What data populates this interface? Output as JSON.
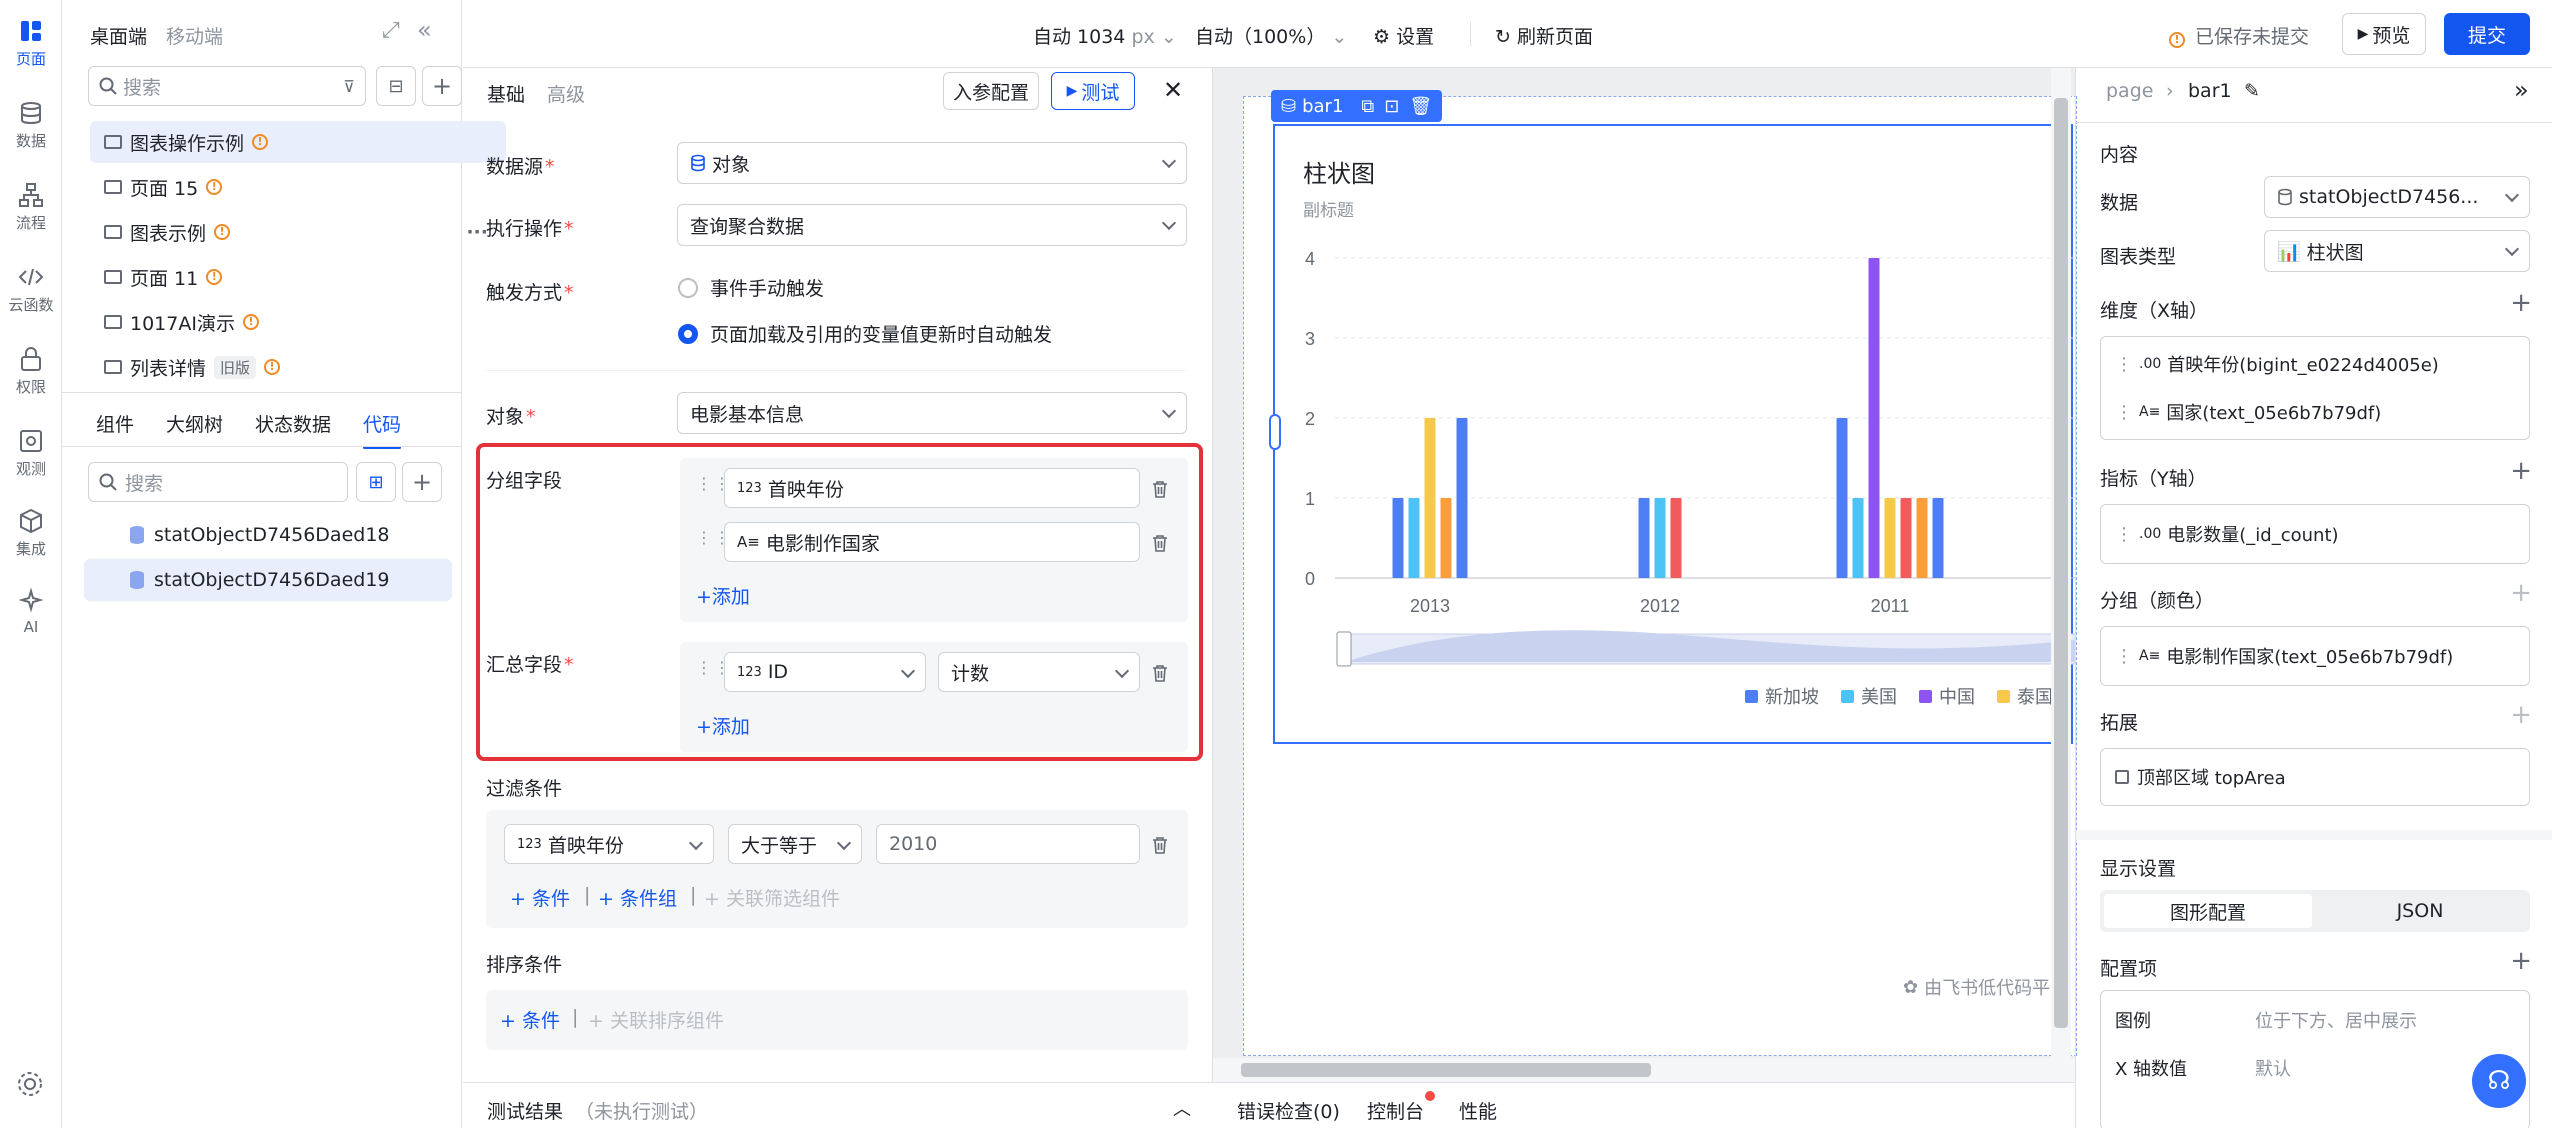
{
  "rail": {
    "items": [
      {
        "label": "页面",
        "icon": "pages-icon"
      },
      {
        "label": "数据",
        "icon": "database-icon"
      },
      {
        "label": "流程",
        "icon": "flow-icon"
      },
      {
        "label": "云函数",
        "icon": "code-icon"
      },
      {
        "label": "权限",
        "icon": "lock-icon"
      },
      {
        "label": "观测",
        "icon": "monitor-icon"
      },
      {
        "label": "集成",
        "icon": "cube-icon"
      },
      {
        "label": "AI",
        "icon": "sparkle-icon"
      }
    ]
  },
  "leftpanel": {
    "platform_tabs": [
      "桌面端",
      "移动端"
    ],
    "search_placeholder": "搜索",
    "pages": [
      {
        "label": "图表操作示例"
      },
      {
        "label": "页面 15"
      },
      {
        "label": "图表示例"
      },
      {
        "label": "页面 11"
      },
      {
        "label": "1017AI演示"
      },
      {
        "label": "列表详情",
        "badge": "旧版"
      }
    ],
    "more": "···",
    "tabs": [
      "组件",
      "大纲树",
      "状态数据",
      "代码"
    ],
    "code_search_placeholder": "搜索",
    "code_items": [
      "statObjectD7456Daed18",
      "statObjectD7456Daed19"
    ]
  },
  "topbar": {
    "width_label": "自动 1034",
    "width_unit": "px",
    "zoom_label": "自动（100%）",
    "settings_label": "设置",
    "refresh_label": "刷新页面",
    "unsaved_label": "已保存未提交",
    "preview_label": "预览",
    "submit_label": "提交"
  },
  "config": {
    "tabs": [
      "基础",
      "高级"
    ],
    "params_button": "入参配置",
    "test_button": "测试",
    "datasource_label": "数据源",
    "datasource_value": "对象",
    "operation_label": "执行操作",
    "operation_value": "查询聚合数据",
    "trigger_label": "触发方式",
    "trigger_options": [
      "事件手动触发",
      "页面加载及引用的变量值更新时自动触发"
    ],
    "object_label": "对象",
    "object_value": "电影基本信息",
    "group_label": "分组字段",
    "group_fields": [
      {
        "type": "123",
        "name": "首映年份"
      },
      {
        "type": "A≡",
        "name": "电影制作国家"
      }
    ],
    "add_label": "添加",
    "agg_label": "汇总字段",
    "agg_field_type": "123",
    "agg_field": "ID",
    "agg_func": "计数",
    "filter_label": "过滤条件",
    "filter_field_type": "123",
    "filter_field": "首映年份",
    "filter_op": "大于等于",
    "filter_value": "2010",
    "cond_label": "条件",
    "cond_group_label": "条件组",
    "link_filter_label": "关联筛选组件",
    "sort_label": "排序条件",
    "link_sort_label": "关联排序组件",
    "result_label": "测试结果",
    "result_status": "（未执行测试）"
  },
  "canvas": {
    "component_tag": "bar1",
    "watermark": "由飞书低代码平"
  },
  "chart_data": {
    "type": "bar",
    "title": "柱状图",
    "subtitle": "副标题",
    "categories": [
      "2013",
      "2012",
      "2011"
    ],
    "yticks": [
      "0",
      "1",
      "2",
      "3",
      "4"
    ],
    "ylim": [
      0,
      4
    ],
    "series_values": [
      [
        1,
        1,
        2,
        1,
        2
      ],
      [
        1,
        1,
        1
      ],
      [
        2,
        1,
        4,
        1,
        1,
        1,
        1
      ]
    ],
    "series_colors": [
      [
        "#4e7ef6",
        "#4cc3f4",
        "#f7c948",
        "#f99e3b",
        "#4e7ef6"
      ],
      [
        "#4e7ef6",
        "#4cc3f4",
        "#f25b5b"
      ],
      [
        "#4e7ef6",
        "#4cc3f4",
        "#8e54f1",
        "#f7c948",
        "#f25b5b",
        "#f99e3b",
        "#4e7ef6"
      ]
    ],
    "legend": [
      {
        "name": "新加坡",
        "color": "#4e7ef6"
      },
      {
        "name": "美国",
        "color": "#4cc3f4"
      },
      {
        "name": "中国",
        "color": "#8e54f1"
      },
      {
        "name": "泰国",
        "color": "#f7c948"
      }
    ]
  },
  "right": {
    "breadcrumb_root": "page",
    "breadcrumb_current": "bar1",
    "content_label": "内容",
    "data_label": "数据",
    "data_value": "statObjectD7456...",
    "chart_type_label": "图表类型",
    "chart_type_value": "柱状图",
    "dimension_label": "维度（X轴）",
    "dimension_items": [
      {
        "type": ".00",
        "name": "首映年份(bigint_e0224d4005e)"
      },
      {
        "type": "A≡",
        "name": "国家(text_05e6b7b79df)"
      }
    ],
    "metric_label": "指标（Y轴）",
    "metric_items": [
      {
        "type": ".00",
        "name": "电影数量(_id_count)"
      }
    ],
    "group_label": "分组（颜色）",
    "group_items": [
      {
        "type": "A≡",
        "name": "电影制作国家(text_05e6b7b79df)"
      }
    ],
    "extend_label": "拓展",
    "extend_item": "顶部区域 topArea",
    "display_label": "显示设置",
    "display_tabs": [
      "图形配置",
      "JSON"
    ],
    "config_label": "配置项",
    "config_rows": [
      {
        "key": "图例",
        "value": "位于下方、居中展示"
      },
      {
        "key": "X 轴数值",
        "value": "默认"
      }
    ]
  },
  "bottom": {
    "tabs": [
      "错误检查(0)",
      "控制台",
      "性能"
    ]
  }
}
